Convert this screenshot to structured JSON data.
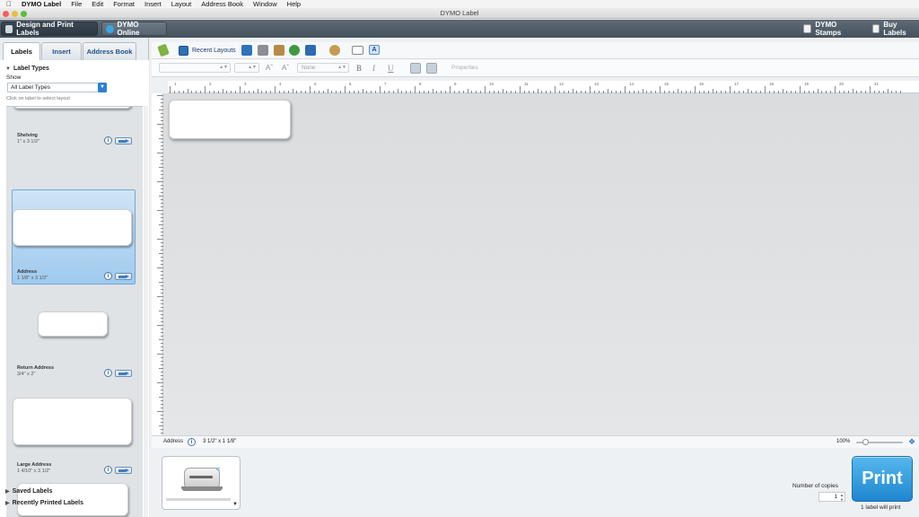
{
  "menubar": {
    "app_name": "DYMO Label",
    "items": [
      "File",
      "Edit",
      "Format",
      "Insert",
      "Layout",
      "Address Book",
      "Window",
      "Help"
    ]
  },
  "window": {
    "title": "DYMO Label"
  },
  "appbar": {
    "design_label": "Design and Print Labels",
    "online_label": "DYMO Online",
    "stamps_label": "DYMO Stamps",
    "buy_label": "Buy Labels"
  },
  "left_panel": {
    "tabs": [
      "Labels",
      "Insert",
      "Address Book"
    ],
    "active_tab": "Labels",
    "label_types_heading": "Label Types",
    "show_label": "Show",
    "show_select_value": "All Label Types",
    "hint": "Click on label to select layout",
    "label_list": [
      {
        "name": "Shelving",
        "size": "1\" x 3 1/2\""
      },
      {
        "name": "Address",
        "size": "1 1/8\" x 3 1/2\"",
        "selected": true
      },
      {
        "name": "Return Address",
        "size": "3/4\" x 2\""
      },
      {
        "name": "Large Address",
        "size": "1 4/10\" x 3 1/2\""
      }
    ],
    "saved_labels": "Saved Labels",
    "recent_labels": "Recently Printed Labels"
  },
  "toolbar": {
    "recent_layouts": "Recent Layouts",
    "none_field": "None",
    "bold": "B",
    "italic": "I",
    "underline": "U",
    "properties": "Properties"
  },
  "ruler": {
    "numbers": [
      "1",
      "2",
      "3",
      "4",
      "5",
      "6",
      "7",
      "8",
      "9",
      "10",
      "11",
      "12",
      "13",
      "14",
      "15",
      "16",
      "17",
      "18",
      "19",
      "20",
      "21"
    ]
  },
  "statusbar": {
    "label_type": "Address",
    "label_size": "3 1/2\" x 1 1/8\"",
    "zoom": "100%",
    "zoom_value": 0.2
  },
  "print_area": {
    "copies_label": "Number of copies",
    "copies_value": "1",
    "print_button": "Print",
    "print_status": "1 label will print"
  },
  "colors": {
    "print_button": "#2b94db",
    "selected_item": "#a8cff0",
    "appbar": "#505c68"
  }
}
